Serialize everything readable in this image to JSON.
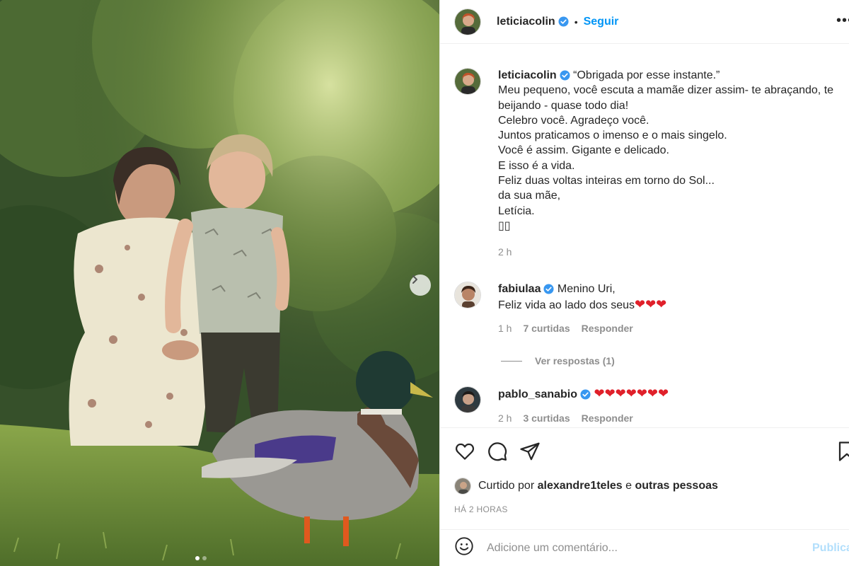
{
  "post": {
    "author": "leticiacolin",
    "follow_label": "Seguir",
    "separator": "•",
    "more_label": "•••"
  },
  "caption": {
    "username": "leticiacolin",
    "lines": [
      "“Obrigada por esse instante.”",
      "Meu pequeno, você escuta a mamãe dizer assim- te abraçando, te",
      "beijando - quase todo dia!",
      "Celebro você. Agradeço você.",
      "Juntos praticamos o imenso e o mais singelo.",
      "Você é assim. Gigante e delicado.",
      "E isso é a vida.",
      "Feliz duas voltas inteiras em torno do Sol...",
      "da sua mãe,",
      "Letícia.",
      "▯▯"
    ],
    "time": "2 h"
  },
  "comments": [
    {
      "username": "fabiulaa",
      "line1": "Menino Uri,",
      "line2": "Feliz vida ao lado dos seus",
      "hearts": "❤❤❤",
      "time": "1 h",
      "likes": "7 curtidas",
      "reply": "Responder"
    },
    {
      "username": "pablo_sanabio",
      "hearts": "❤❤❤❤❤❤❤",
      "time": "2 h",
      "likes": "3 curtidas",
      "reply": "Responder"
    }
  ],
  "view_replies": "Ver respostas (1)",
  "likes": {
    "prefix": "Curtido por",
    "user": "alexandre1teles",
    "connector": "e",
    "others": "outras pessoas"
  },
  "date": "HÁ 2 HORAS",
  "add_comment": {
    "placeholder": "Adicione um comentário...",
    "publish_label": "Publicar"
  },
  "carousel": {
    "slides": 2,
    "active": 1
  },
  "colors": {
    "link": "#0095f6",
    "verified": "#3897f0",
    "secondary_text": "#8e8e8e",
    "publish_disabled": "#b2dffc"
  },
  "icons": [
    "verified-icon",
    "heart-icon",
    "comment-icon",
    "share-icon",
    "bookmark-icon",
    "emoji-icon",
    "chevron-right-icon"
  ]
}
